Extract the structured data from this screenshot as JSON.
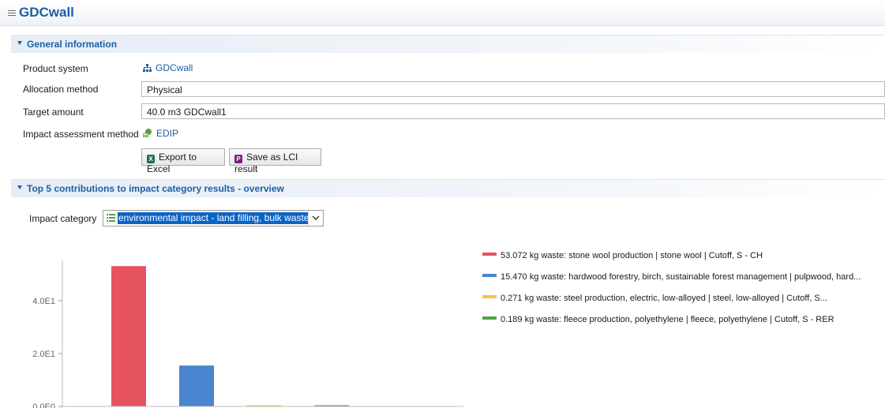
{
  "window": {
    "title": "GDCwall"
  },
  "general": {
    "header": "General information",
    "product_system_label": "Product system",
    "product_system_value": "GDCwall",
    "allocation_label": "Allocation method",
    "allocation_value": "Physical",
    "target_label": "Target amount",
    "target_value": "40.0 m3 GDCwall1",
    "impact_method_label": "Impact assessment method",
    "impact_method_value": "EDIP",
    "export_button": "Export to Excel",
    "save_button": "Save as LCI result"
  },
  "contributions": {
    "header": "Top 5 contributions to impact category results - overview",
    "impact_category_label": "Impact category",
    "impact_category_value": "environmental impact - land filling, bulk waste"
  },
  "colors": {
    "accent": "#1d5fa5",
    "excel": "#1e7145",
    "lci": "#7a1f7d"
  },
  "chart_data": {
    "type": "bar",
    "ylim": [
      0,
      55
    ],
    "yticks": [
      {
        "value": 0,
        "label": "0.0E0"
      },
      {
        "value": 20,
        "label": "2.0E1"
      },
      {
        "value": 40,
        "label": "4.0E1"
      }
    ],
    "series": [
      {
        "name": "53.072 kg waste: stone wool production | stone wool | Cutoff, S - CH",
        "value": 53.072,
        "color": "#e5535e"
      },
      {
        "name": "15.470 kg waste: hardwood forestry, birch, sustainable forest management | pulpwood, hard...",
        "value": 15.47,
        "color": "#4a86cf"
      },
      {
        "name": "0.271 kg waste: steel production, electric, low-alloyed | steel, low-alloyed | Cutoff, S...",
        "value": 0.271,
        "color": "#f6c343"
      },
      {
        "name": "0.189 kg waste: fleece production, polyethylene | fleece, polyethylene | Cutoff, S - RER",
        "value": 0.189,
        "color": "#55a14a"
      }
    ],
    "legend_position": "right"
  }
}
